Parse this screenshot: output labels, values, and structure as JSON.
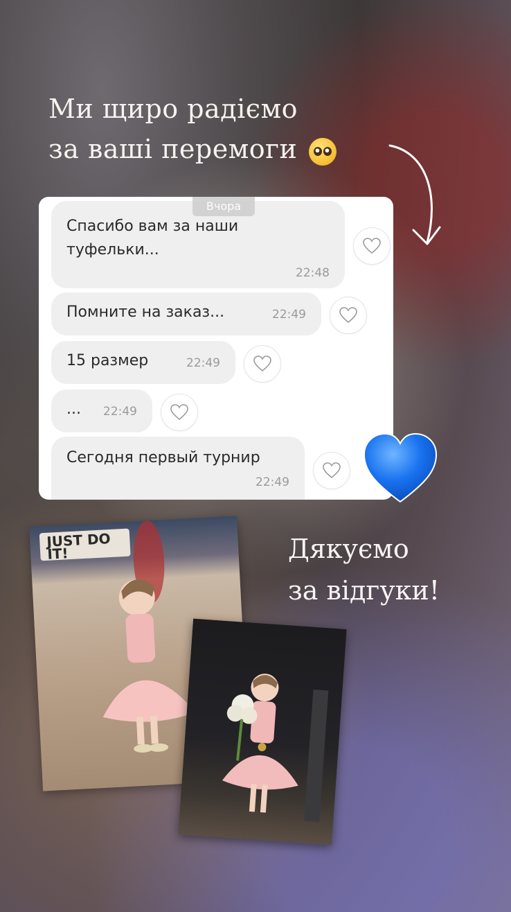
{
  "story": {
    "headline_line1": "Ми щиро радіємо",
    "headline_line2": "за ваші перемоги",
    "headline_emoji": "pleading-face-icon",
    "thanks_line1": "Дякуємо",
    "thanks_line2": "за відгуки!"
  },
  "chat": {
    "day_label": "Вчора",
    "messages": [
      {
        "text_line1": "Спасибо вам за наши",
        "text_line2": "туфельки...",
        "time": "22:48"
      },
      {
        "text_line1": "Помните на заказ...",
        "time": "22:49"
      },
      {
        "text_line1": "15 размер",
        "time": "22:49"
      },
      {
        "text_line1": "...",
        "time": "22:49"
      },
      {
        "text_line1": "Сегодня первый турнир",
        "time": "22:49"
      }
    ]
  },
  "photos": {
    "photo1_banner_text": "JUST DO IT!"
  },
  "colors": {
    "heart": "#1a73f0",
    "bubble": "#efefef",
    "chat_bg": "#ffffff"
  }
}
